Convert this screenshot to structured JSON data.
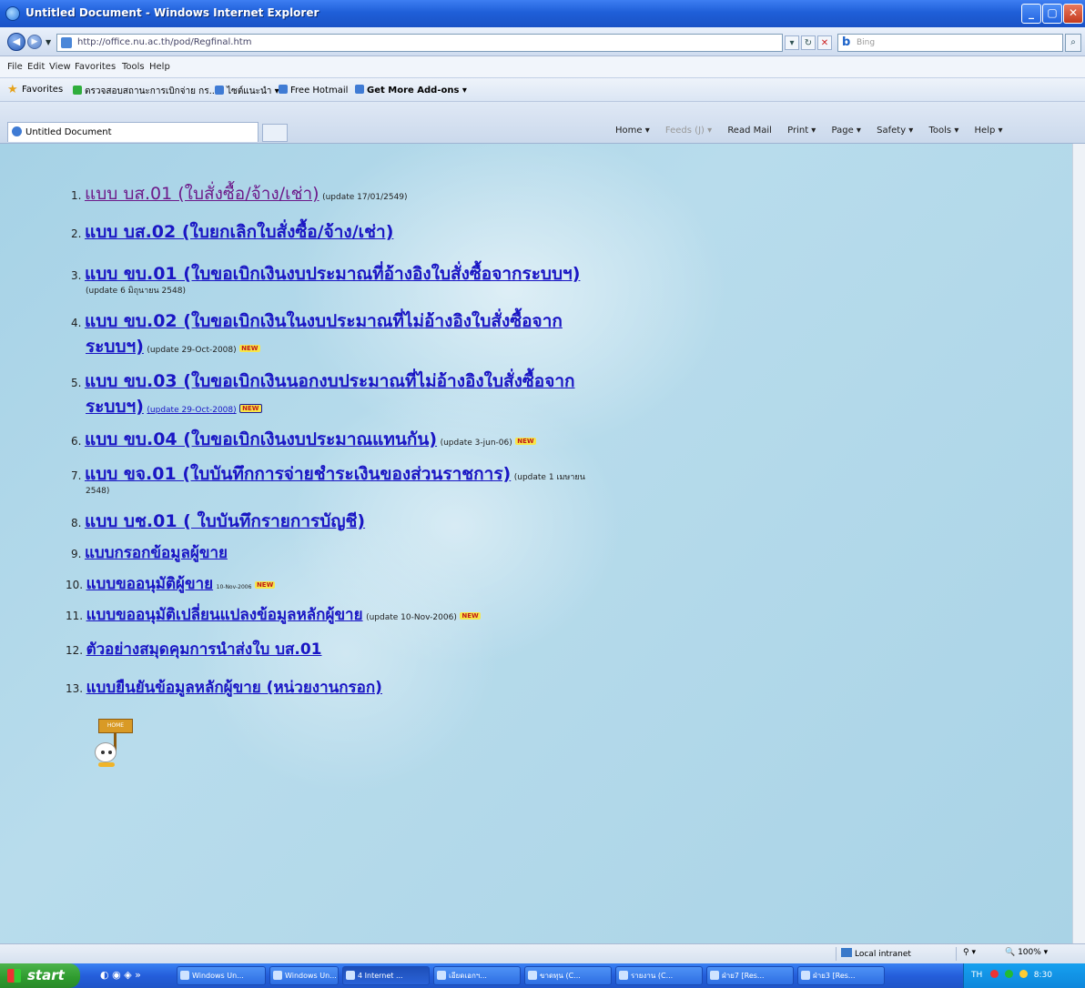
{
  "window": {
    "title": "Untitled Document - Windows Internet Explorer",
    "min": "_",
    "max": "▢",
    "close": "✕"
  },
  "address_bar": {
    "url": "http://office.nu.ac.th/pod/Regfinal.htm",
    "search_placeholder": "Bing",
    "refresh": "↻",
    "stop": "✕",
    "go": "⌕"
  },
  "menu": [
    "File",
    "Edit",
    "View",
    "Favorites",
    "Tools",
    "Help"
  ],
  "favorites_bar": {
    "label": "Favorites",
    "items": [
      "ตรวจสอบสถานะการเบิกจ่าย กร...",
      "ไซต์แนะนำ ▾",
      "Free Hotmail",
      "Get More Add-ons ▾"
    ]
  },
  "tab": {
    "label": "Untitled Document"
  },
  "command_bar": [
    "Home ▾",
    "Feeds (J) ▾",
    "Read Mail",
    "Print ▾",
    "Page ▾",
    "Safety ▾",
    "Tools ▾",
    "Help ▾"
  ],
  "items": [
    {
      "num": "1.",
      "link": "แบบ บส.01 (ใบสั่งซื้อ/จ้าง/เช่า)",
      "note": "(update 17/01/2549)"
    },
    {
      "num": "2.",
      "link": "แบบ บส.02 (ใบยกเลิกใบสั่งซื้อ/จ้าง/เช่า)"
    },
    {
      "num": "3.",
      "link": "แบบ ขบ.01 (ใบขอเบิกเงินงบประมาณที่อ้างอิงใบสั่งซื้อจากระบบฯ)",
      "note": "(update 6 มิถุนายน 2548)"
    },
    {
      "num": "4.",
      "link": "แบบ ขบ.02 (ใบขอเบิกเงินในงบประมาณที่ไม่อ้างอิงใบสั่งซื้อจาก",
      "link2": "ระบบฯ)",
      "note": "(update 29-Oct-2008)",
      "badge": "NEW"
    },
    {
      "num": "5.",
      "link": "แบบ ขบ.03 (ใบขอเบิกเงินนอกงบประมาณที่ไม่อ้างอิงใบสั่งซื้อจาก",
      "link2": "ระบบฯ)",
      "note": "(update 29-Oct-2008)",
      "badge": "NEW"
    },
    {
      "num": "6.",
      "link": "แบบ ขบ.04 (ใบขอเบิกเงินงบประมาณแทนกัน)",
      "note": "(update 3-jun-06)",
      "badge": "NEW"
    },
    {
      "num": "7.",
      "link": "แบบ ขจ.01 (ใบบันทึกการจ่ายชำระเงินของส่วนราชการ)",
      "note": "(update 1 เมษายน",
      "note2": "2548)"
    },
    {
      "num": "8.",
      "link": "แบบ บช.01 ( ใบบันทึกรายการบัญชี)"
    },
    {
      "num": "9.",
      "link": "แบบกรอกข้อมูลผู้ขาย"
    },
    {
      "num": "10.",
      "link": "แบบขออนุมัติผู้ขาย",
      "note": "10-Nov-2006",
      "badge": "NEW"
    },
    {
      "num": "11.",
      "link": "แบบขออนุมัติเปลี่ยนแปลงข้อมูลหลักผู้ขาย",
      "note": "(update 10-Nov-2006)",
      "badge": "NEW"
    },
    {
      "num": "12.",
      "link": "ตัวอย่างสมุดคุมการนำส่งใบ บส.01"
    },
    {
      "num": "13.",
      "link": "แบบยืนยันข้อมูลหลักผู้ขาย (หน่วยงานกรอก)"
    }
  ],
  "mascot": {
    "sign": "HOME"
  },
  "status_bar": {
    "zone": "Local intranet",
    "zoom": "🔍 100% ▾",
    "protected": "⚲ ▾"
  },
  "taskbar": {
    "start": "start",
    "quick_launch": "◐ ◉ ◈ »",
    "tasks": [
      "Windows Un...",
      "Windows Un...",
      "4 Internet ...",
      "เอียดเอกฯ...",
      "ขาดทุน (C...",
      "รายงาน (C...",
      "ฝ่าย7 [Res...",
      "ฝ่าย3 [Res..."
    ],
    "tray_lang": "TH",
    "tray_time": "8:30"
  }
}
